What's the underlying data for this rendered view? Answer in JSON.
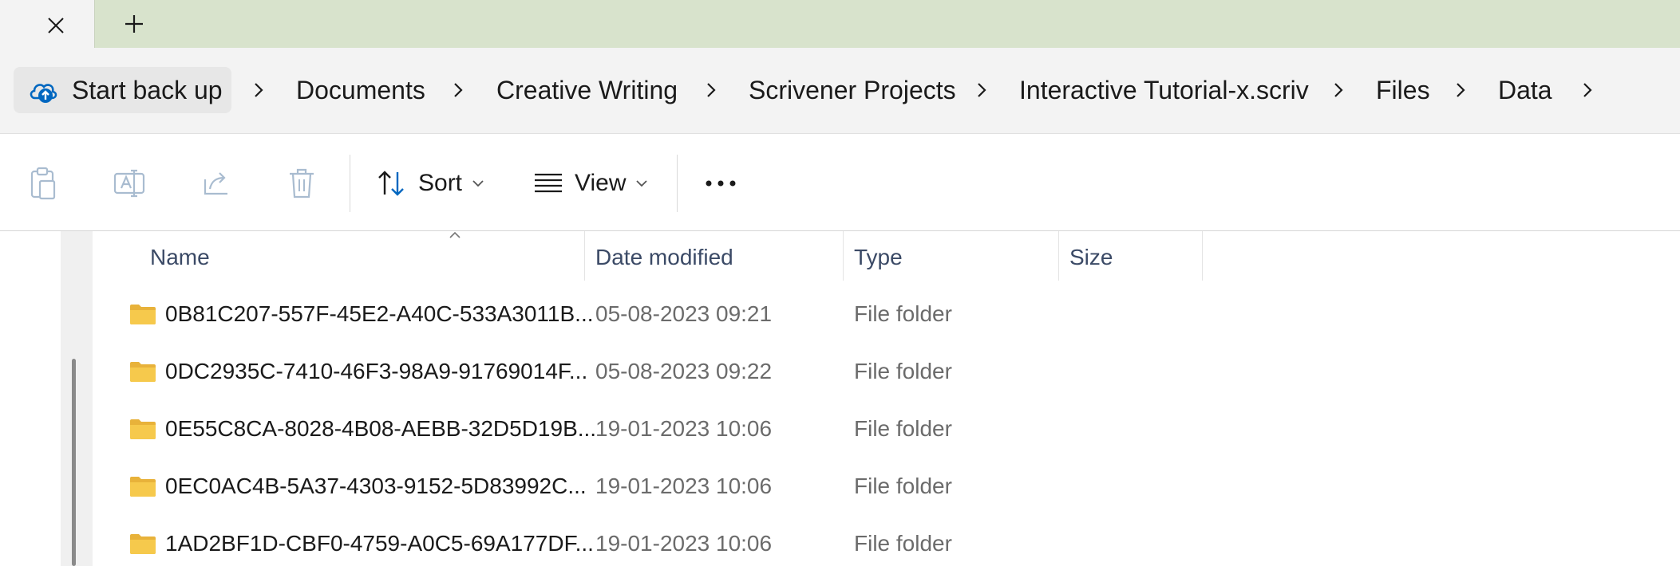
{
  "tabs": {
    "close_icon": "close-icon",
    "new_tab_icon": "plus-icon"
  },
  "breadcrumb": {
    "home_label": "Start back up",
    "items": [
      "Documents",
      "Creative Writing",
      "Scrivener Projects",
      "Interactive Tutorial-x.scriv",
      "Files",
      "Data"
    ]
  },
  "toolbar": {
    "sort_label": "Sort",
    "view_label": "View"
  },
  "columns": {
    "name": "Name",
    "date": "Date modified",
    "type": "Type",
    "size": "Size"
  },
  "files": [
    {
      "name": "0B81C207-557F-45E2-A40C-533A3011B...",
      "date": "05-08-2023 09:21",
      "type": "File folder",
      "size": ""
    },
    {
      "name": "0DC2935C-7410-46F3-98A9-91769014F...",
      "date": "05-08-2023 09:22",
      "type": "File folder",
      "size": ""
    },
    {
      "name": "0E55C8CA-8028-4B08-AEBB-32D5D19B...",
      "date": "19-01-2023 10:06",
      "type": "File folder",
      "size": ""
    },
    {
      "name": "0EC0AC4B-5A37-4303-9152-5D83992C...",
      "date": "19-01-2023 10:06",
      "type": "File folder",
      "size": ""
    },
    {
      "name": "1AD2BF1D-CBF0-4759-A0C5-69A177DF...",
      "date": "19-01-2023 10:06",
      "type": "File folder",
      "size": ""
    }
  ],
  "colors": {
    "tabstrip": "#d8e3cc",
    "accent": "#0067c0",
    "folder": "#f6c94c"
  }
}
